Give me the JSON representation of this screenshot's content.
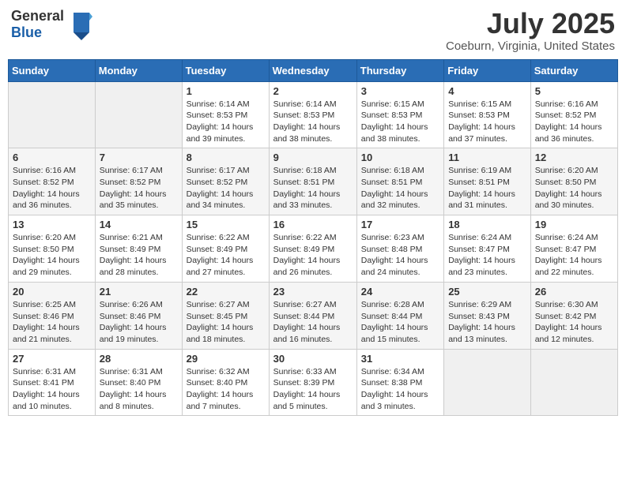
{
  "header": {
    "logo_general": "General",
    "logo_blue": "Blue",
    "month": "July 2025",
    "location": "Coeburn, Virginia, United States"
  },
  "weekdays": [
    "Sunday",
    "Monday",
    "Tuesday",
    "Wednesday",
    "Thursday",
    "Friday",
    "Saturday"
  ],
  "weeks": [
    [
      {
        "day": "",
        "sunrise": "",
        "sunset": "",
        "daylight": ""
      },
      {
        "day": "",
        "sunrise": "",
        "sunset": "",
        "daylight": ""
      },
      {
        "day": "1",
        "sunrise": "Sunrise: 6:14 AM",
        "sunset": "Sunset: 8:53 PM",
        "daylight": "Daylight: 14 hours and 39 minutes."
      },
      {
        "day": "2",
        "sunrise": "Sunrise: 6:14 AM",
        "sunset": "Sunset: 8:53 PM",
        "daylight": "Daylight: 14 hours and 38 minutes."
      },
      {
        "day": "3",
        "sunrise": "Sunrise: 6:15 AM",
        "sunset": "Sunset: 8:53 PM",
        "daylight": "Daylight: 14 hours and 38 minutes."
      },
      {
        "day": "4",
        "sunrise": "Sunrise: 6:15 AM",
        "sunset": "Sunset: 8:53 PM",
        "daylight": "Daylight: 14 hours and 37 minutes."
      },
      {
        "day": "5",
        "sunrise": "Sunrise: 6:16 AM",
        "sunset": "Sunset: 8:52 PM",
        "daylight": "Daylight: 14 hours and 36 minutes."
      }
    ],
    [
      {
        "day": "6",
        "sunrise": "Sunrise: 6:16 AM",
        "sunset": "Sunset: 8:52 PM",
        "daylight": "Daylight: 14 hours and 36 minutes."
      },
      {
        "day": "7",
        "sunrise": "Sunrise: 6:17 AM",
        "sunset": "Sunset: 8:52 PM",
        "daylight": "Daylight: 14 hours and 35 minutes."
      },
      {
        "day": "8",
        "sunrise": "Sunrise: 6:17 AM",
        "sunset": "Sunset: 8:52 PM",
        "daylight": "Daylight: 14 hours and 34 minutes."
      },
      {
        "day": "9",
        "sunrise": "Sunrise: 6:18 AM",
        "sunset": "Sunset: 8:51 PM",
        "daylight": "Daylight: 14 hours and 33 minutes."
      },
      {
        "day": "10",
        "sunrise": "Sunrise: 6:18 AM",
        "sunset": "Sunset: 8:51 PM",
        "daylight": "Daylight: 14 hours and 32 minutes."
      },
      {
        "day": "11",
        "sunrise": "Sunrise: 6:19 AM",
        "sunset": "Sunset: 8:51 PM",
        "daylight": "Daylight: 14 hours and 31 minutes."
      },
      {
        "day": "12",
        "sunrise": "Sunrise: 6:20 AM",
        "sunset": "Sunset: 8:50 PM",
        "daylight": "Daylight: 14 hours and 30 minutes."
      }
    ],
    [
      {
        "day": "13",
        "sunrise": "Sunrise: 6:20 AM",
        "sunset": "Sunset: 8:50 PM",
        "daylight": "Daylight: 14 hours and 29 minutes."
      },
      {
        "day": "14",
        "sunrise": "Sunrise: 6:21 AM",
        "sunset": "Sunset: 8:49 PM",
        "daylight": "Daylight: 14 hours and 28 minutes."
      },
      {
        "day": "15",
        "sunrise": "Sunrise: 6:22 AM",
        "sunset": "Sunset: 8:49 PM",
        "daylight": "Daylight: 14 hours and 27 minutes."
      },
      {
        "day": "16",
        "sunrise": "Sunrise: 6:22 AM",
        "sunset": "Sunset: 8:49 PM",
        "daylight": "Daylight: 14 hours and 26 minutes."
      },
      {
        "day": "17",
        "sunrise": "Sunrise: 6:23 AM",
        "sunset": "Sunset: 8:48 PM",
        "daylight": "Daylight: 14 hours and 24 minutes."
      },
      {
        "day": "18",
        "sunrise": "Sunrise: 6:24 AM",
        "sunset": "Sunset: 8:47 PM",
        "daylight": "Daylight: 14 hours and 23 minutes."
      },
      {
        "day": "19",
        "sunrise": "Sunrise: 6:24 AM",
        "sunset": "Sunset: 8:47 PM",
        "daylight": "Daylight: 14 hours and 22 minutes."
      }
    ],
    [
      {
        "day": "20",
        "sunrise": "Sunrise: 6:25 AM",
        "sunset": "Sunset: 8:46 PM",
        "daylight": "Daylight: 14 hours and 21 minutes."
      },
      {
        "day": "21",
        "sunrise": "Sunrise: 6:26 AM",
        "sunset": "Sunset: 8:46 PM",
        "daylight": "Daylight: 14 hours and 19 minutes."
      },
      {
        "day": "22",
        "sunrise": "Sunrise: 6:27 AM",
        "sunset": "Sunset: 8:45 PM",
        "daylight": "Daylight: 14 hours and 18 minutes."
      },
      {
        "day": "23",
        "sunrise": "Sunrise: 6:27 AM",
        "sunset": "Sunset: 8:44 PM",
        "daylight": "Daylight: 14 hours and 16 minutes."
      },
      {
        "day": "24",
        "sunrise": "Sunrise: 6:28 AM",
        "sunset": "Sunset: 8:44 PM",
        "daylight": "Daylight: 14 hours and 15 minutes."
      },
      {
        "day": "25",
        "sunrise": "Sunrise: 6:29 AM",
        "sunset": "Sunset: 8:43 PM",
        "daylight": "Daylight: 14 hours and 13 minutes."
      },
      {
        "day": "26",
        "sunrise": "Sunrise: 6:30 AM",
        "sunset": "Sunset: 8:42 PM",
        "daylight": "Daylight: 14 hours and 12 minutes."
      }
    ],
    [
      {
        "day": "27",
        "sunrise": "Sunrise: 6:31 AM",
        "sunset": "Sunset: 8:41 PM",
        "daylight": "Daylight: 14 hours and 10 minutes."
      },
      {
        "day": "28",
        "sunrise": "Sunrise: 6:31 AM",
        "sunset": "Sunset: 8:40 PM",
        "daylight": "Daylight: 14 hours and 8 minutes."
      },
      {
        "day": "29",
        "sunrise": "Sunrise: 6:32 AM",
        "sunset": "Sunset: 8:40 PM",
        "daylight": "Daylight: 14 hours and 7 minutes."
      },
      {
        "day": "30",
        "sunrise": "Sunrise: 6:33 AM",
        "sunset": "Sunset: 8:39 PM",
        "daylight": "Daylight: 14 hours and 5 minutes."
      },
      {
        "day": "31",
        "sunrise": "Sunrise: 6:34 AM",
        "sunset": "Sunset: 8:38 PM",
        "daylight": "Daylight: 14 hours and 3 minutes."
      },
      {
        "day": "",
        "sunrise": "",
        "sunset": "",
        "daylight": ""
      },
      {
        "day": "",
        "sunrise": "",
        "sunset": "",
        "daylight": ""
      }
    ]
  ]
}
